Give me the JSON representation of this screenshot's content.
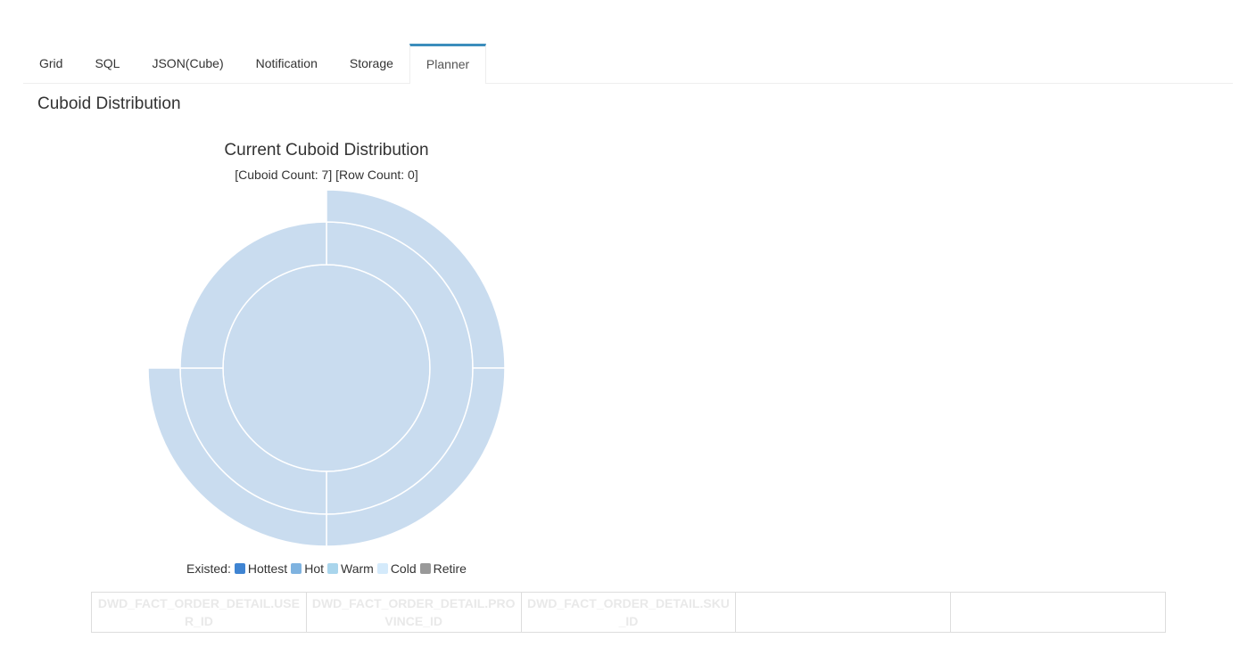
{
  "tabs": [
    {
      "label": "Grid",
      "active": false
    },
    {
      "label": "SQL",
      "active": false
    },
    {
      "label": "JSON(Cube)",
      "active": false
    },
    {
      "label": "Notification",
      "active": false
    },
    {
      "label": "Storage",
      "active": false
    },
    {
      "label": "Planner",
      "active": true
    }
  ],
  "section_title": "Cuboid Distribution",
  "chart_data": {
    "type": "sunburst",
    "title": "Current Cuboid Distribution",
    "subtitle": "[Cuboid Count: 7] [Row Count: 0]",
    "fill_color": "#c9dcef",
    "stroke_color": "#ffffff",
    "rings": [
      {
        "level": 1,
        "segments": [
          {
            "start": 0,
            "end": 1
          }
        ]
      },
      {
        "level": 2,
        "segments": [
          {
            "start": 0,
            "end": 0.5
          },
          {
            "start": 0.5,
            "end": 0.75
          },
          {
            "start": 0.75,
            "end": 1
          }
        ]
      },
      {
        "level": 3,
        "segments": [
          {
            "start": 0,
            "end": 0.25
          },
          {
            "start": 0.25,
            "end": 0.5
          },
          {
            "start": 0.5,
            "end": 0.75
          }
        ]
      }
    ],
    "legend": {
      "prefix": "Existed:",
      "items": [
        {
          "label": "Hottest",
          "color": "#3f84d2"
        },
        {
          "label": "Hot",
          "color": "#7fb3e0"
        },
        {
          "label": "Warm",
          "color": "#a9d5ec"
        },
        {
          "label": "Cold",
          "color": "#d4eafb"
        },
        {
          "label": "Retire",
          "color": "#999999"
        }
      ]
    }
  },
  "dimension_table": {
    "cells": [
      "DWD_FACT_ORDER_DETAIL.USER_ID",
      "DWD_FACT_ORDER_DETAIL.PROVINCE_ID",
      "DWD_FACT_ORDER_DETAIL.SKU_ID",
      "",
      ""
    ]
  }
}
